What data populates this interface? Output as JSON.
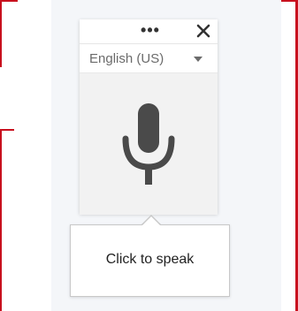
{
  "dictation": {
    "more_icon": "more-horizontal-icon",
    "close_icon": "close-icon",
    "language": "English (US)",
    "language_dropdown_icon": "chevron-down-icon",
    "mic_icon": "microphone-icon"
  },
  "tooltip": {
    "text": "Click to speak"
  },
  "colors": {
    "frame_border": "#c8101e",
    "panel_background": "#f4f6f9",
    "mic_color": "#4a4a4a"
  }
}
